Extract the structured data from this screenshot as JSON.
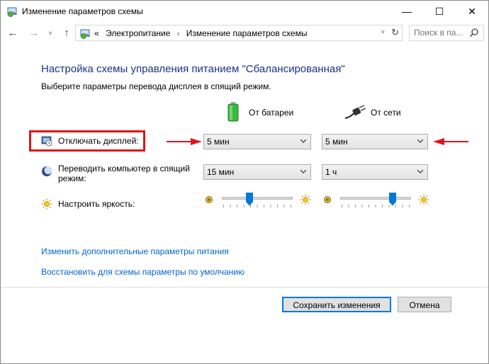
{
  "window": {
    "title": "Изменение параметров схемы",
    "minimize_glyph": "—",
    "maximize_glyph": "☐",
    "close_glyph": "✕"
  },
  "nav": {
    "back_glyph": "←",
    "forward_glyph": "→",
    "history_glyph": "˅",
    "up_glyph": "↑",
    "breadcrumb_prefix": "«",
    "breadcrumbs": [
      "Электропитание",
      "Изменение параметров схемы"
    ],
    "breadcrumb_separator": "›",
    "address_chevron": "˅",
    "refresh_glyph": "↻",
    "search_placeholder": "Поиск в па..."
  },
  "content": {
    "heading": "Настройка схемы управления питанием \"Сбалансированная\"",
    "subheading": "Выберите параметры перевода дисплея в спящий режим.",
    "columns": {
      "battery": "От батареи",
      "plugged": "От сети"
    },
    "rows": {
      "display": {
        "label": "Отключать дисплей:",
        "battery_value": "5 мин",
        "plugged_value": "5 мин"
      },
      "sleep": {
        "label_line1": "Переводить компьютер в спящий",
        "label_line2": "режим:",
        "battery_value": "15 мин",
        "plugged_value": "1 ч"
      },
      "brightness": {
        "label": "Настроить яркость:",
        "battery_level": 0.4,
        "plugged_level": 0.75
      }
    },
    "links": {
      "advanced": "Изменить дополнительные параметры питания",
      "restore": "Восстановить для схемы параметры по умолчанию"
    },
    "buttons": {
      "save": "Сохранить изменения",
      "cancel": "Отмена"
    }
  },
  "colors": {
    "heading": "#1e3287",
    "link": "#0066cc",
    "annotation_red": "#e0141b",
    "slider_thumb": "#0078d7",
    "battery_green": "#3cb83c"
  },
  "icons": {
    "app": "power-options-icon",
    "address": "power-options-icon",
    "search": "search-icon",
    "battery": "battery-icon",
    "plug": "power-plug-icon",
    "display": "monitor-clock-icon",
    "sleep": "moon-icon",
    "brightness": "sun-icon"
  }
}
